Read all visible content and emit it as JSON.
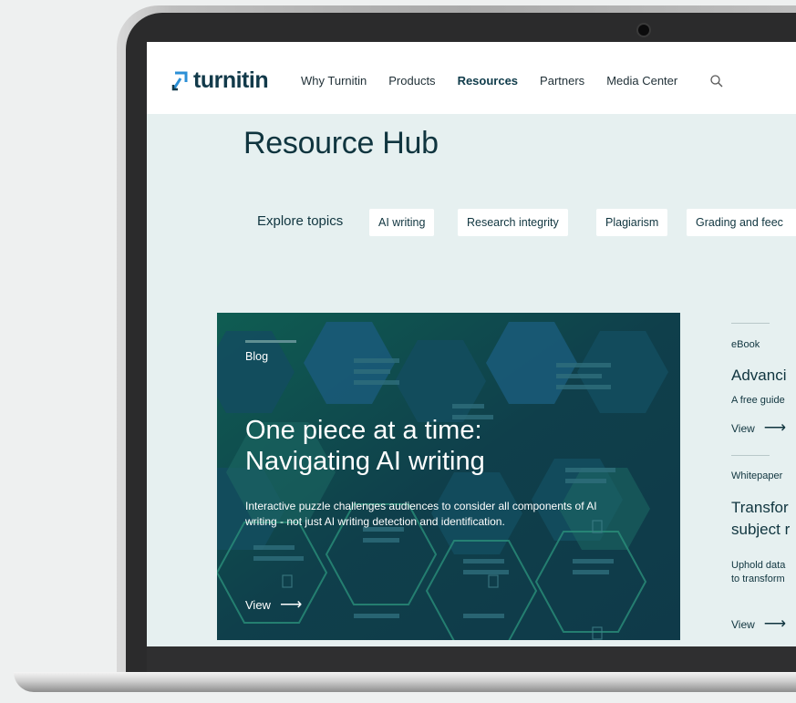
{
  "nav": {
    "logo_text": "turnitin",
    "items": [
      {
        "label": "Why Turnitin"
      },
      {
        "label": "Products"
      },
      {
        "label": "Resources"
      },
      {
        "label": "Partners"
      },
      {
        "label": "Media Center"
      }
    ],
    "active_item": "Resources",
    "search_icon": "search-icon"
  },
  "hub": {
    "title": "Resource Hub",
    "topics_label": "Explore topics",
    "topics": [
      {
        "label": "AI writing"
      },
      {
        "label": "Research integrity"
      },
      {
        "label": "Plagiarism"
      },
      {
        "label": "Grading and feec"
      }
    ]
  },
  "feature": {
    "tag": "Blog",
    "title_line1": "One piece at a time:",
    "title_line2": "Navigating AI writing",
    "desc_line1": "Interactive puzzle challenges audiences to consider all components of AI",
    "desc_line2": "writing - not just AI writing detection and identification.",
    "view_label": "View",
    "arrow": "⟶"
  },
  "side": [
    {
      "kind": "eBook",
      "title_lines": [
        "Advanci"
      ],
      "desc_lines": [
        "A free guide"
      ],
      "view_label": "View"
    },
    {
      "kind": "Whitepaper",
      "title_lines": [
        "Transfor",
        "subject r"
      ],
      "desc_lines": [
        "Uphold data",
        "to transform"
      ],
      "view_label": "View"
    }
  ],
  "colors": {
    "brand_dark": "#10353f",
    "card_bg": "#0f3d4a",
    "page_bg": "#e6f0f0",
    "logo_blue": "#2b8fd6"
  }
}
